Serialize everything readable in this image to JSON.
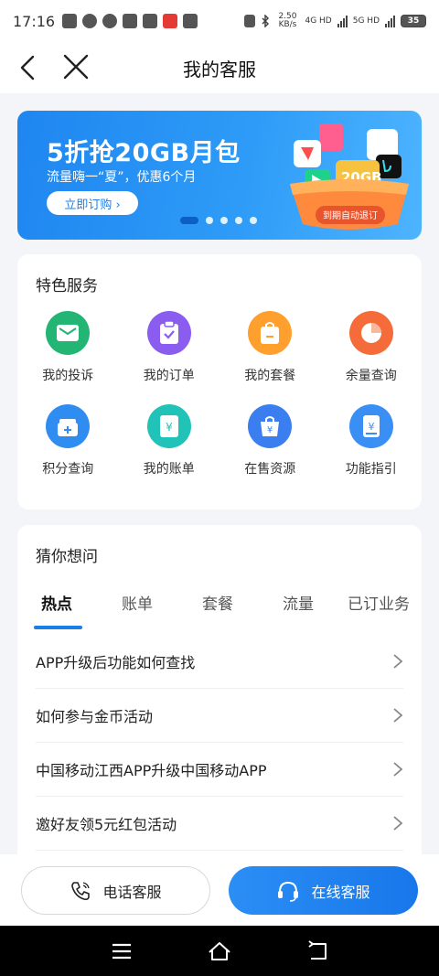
{
  "status_bar": {
    "time": "17:16",
    "net_speed": "2.50 KB/s",
    "net_4g": "4G HD",
    "net_5g": "5G HD",
    "battery": "35"
  },
  "nav": {
    "title": "我的客服"
  },
  "banner": {
    "title": "5折抢20GB月包",
    "subtitle": "流量嗨一“夏”，优惠6个月",
    "button": "立即订购 ›",
    "art_text": "20GB",
    "art_bottom": "到期自动退订",
    "total_slides": 5,
    "active_slide": 1
  },
  "services": {
    "title": "特色服务",
    "items": [
      {
        "label": "我的投诉",
        "icon": "mail-icon",
        "color": "#22b573"
      },
      {
        "label": "我的订单",
        "icon": "clipboard-check-icon",
        "color": "#8a5cf0"
      },
      {
        "label": "我的套餐",
        "icon": "bag-icon",
        "color": "#ff9f2d"
      },
      {
        "label": "余量查询",
        "icon": "pie-chart-icon",
        "color": "#f56c3a"
      },
      {
        "label": "积分查询",
        "icon": "gift-box-icon",
        "color": "#2f8cf0"
      },
      {
        "label": "我的账单",
        "icon": "bill-icon",
        "color": "#21c2b8"
      },
      {
        "label": "在售资源",
        "icon": "shop-bag-icon",
        "color": "#3a7ef0"
      },
      {
        "label": "功能指引",
        "icon": "guide-book-icon",
        "color": "#3a8ff5"
      }
    ]
  },
  "faq": {
    "title": "猜你想问",
    "tabs": [
      "热点",
      "账单",
      "套餐",
      "流量",
      "已订业务"
    ],
    "active_tab": "热点",
    "items": [
      "APP升级后功能如何查找",
      "如何参与金币活动",
      "中国移动江西APP升级中国移动APP",
      "邀好友领5元红包活动"
    ]
  },
  "actions": {
    "phone_service": "电话客服",
    "online_service": "在线客服"
  }
}
